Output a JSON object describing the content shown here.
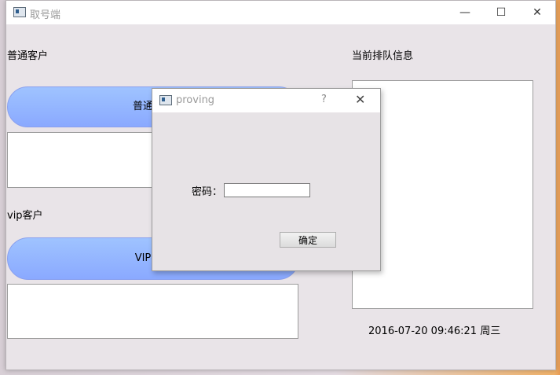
{
  "window": {
    "title": "取号端",
    "minimize_glyph": "—",
    "maximize_glyph": "☐",
    "close_glyph": "✕"
  },
  "left": {
    "normal_section_label": "普通客户",
    "normal_button_label": "普通客户",
    "vip_section_label": "vip客户",
    "vip_button_label": "VIP客户"
  },
  "right": {
    "queue_label": "当前排队信息",
    "datetime": "2016-07-20 09:46:21 周三"
  },
  "dialog": {
    "title": "proving",
    "help_glyph": "?",
    "close_glyph": "✕",
    "password_label": "密码：",
    "password_value": "",
    "ok_label": "确定"
  },
  "colors": {
    "pill_top": "#9fc3ff",
    "pill_bottom": "#8aa9ff",
    "window_bg": "#e9e4e8"
  }
}
